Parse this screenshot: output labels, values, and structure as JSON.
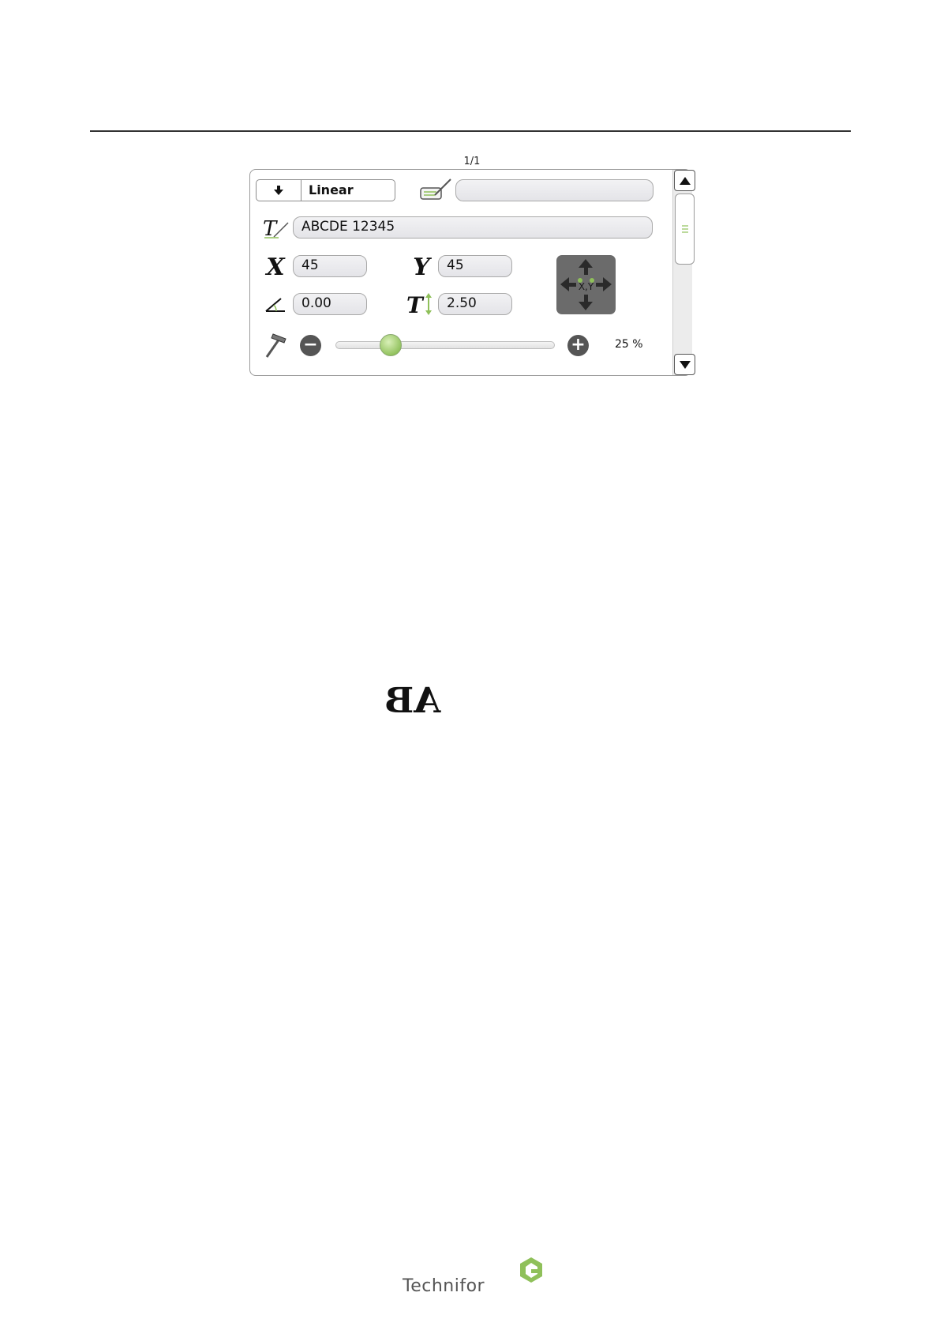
{
  "header": {
    "page_counter": "1/1"
  },
  "panel": {
    "type_select": {
      "value": "Linear"
    },
    "name_field": {
      "value": ""
    },
    "text_field": {
      "value": "ABCDE  12345"
    },
    "x_field": {
      "value": "45"
    },
    "y_field": {
      "value": "45"
    },
    "angle_field": {
      "value": "0.00"
    },
    "height_field": {
      "value": "2.50"
    },
    "force_slider": {
      "percent": 25,
      "label": "25 %"
    }
  },
  "preview": {
    "text": "AB"
  },
  "footer": {
    "brand": "Technifor"
  },
  "colors": {
    "accent_green": "#8fc05a",
    "pad_gray": "#6b6b6b"
  },
  "icons": [
    "down-arrow-icon",
    "label-edit-icon",
    "text-style-icon",
    "angle-icon",
    "text-height-icon",
    "hammer-icon",
    "minus-icon",
    "plus-icon",
    "move-arrows-icon",
    "scroll-up-icon",
    "scroll-down-icon",
    "grip-icon"
  ]
}
